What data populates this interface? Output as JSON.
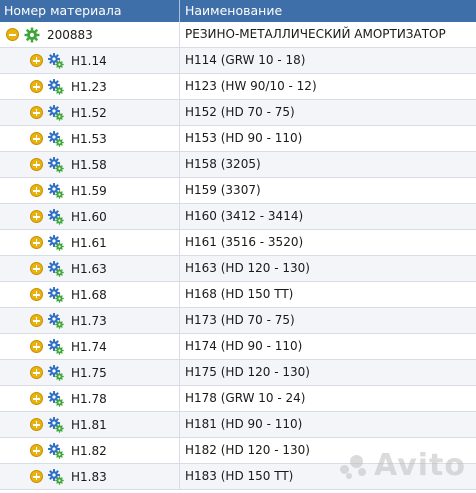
{
  "columns": {
    "material_number": "Номер материала",
    "name": "Наименование"
  },
  "root": {
    "code": "200883",
    "name": "РЕЗИНО-МЕТАЛЛИЧЕСКИЙ АМОРТИЗАТОР",
    "expander": "minus-icon"
  },
  "rows": [
    {
      "code": "H1.14",
      "name": "H114 (GRW 10 - 18)"
    },
    {
      "code": "H1.23",
      "name": "H123 (HW 90/10 - 12)"
    },
    {
      "code": "H1.52",
      "name": "H152 (HD 70 - 75)"
    },
    {
      "code": "H1.53",
      "name": "H153 (HD 90 - 110)"
    },
    {
      "code": "H1.58",
      "name": "H158 (3205)"
    },
    {
      "code": "H1.59",
      "name": "H159 (3307)"
    },
    {
      "code": "H1.60",
      "name": "H160 (3412 - 3414)"
    },
    {
      "code": "H1.61",
      "name": "H161 (3516 - 3520)"
    },
    {
      "code": "H1.63",
      "name": "H163 (HD 120 - 130)"
    },
    {
      "code": "H1.68",
      "name": "H168 (HD 150 TT)"
    },
    {
      "code": "H1.73",
      "name": "H173 (HD 70 - 75)"
    },
    {
      "code": "H1.74",
      "name": "H174 (HD 90 - 110)"
    },
    {
      "code": "H1.75",
      "name": "H175 (HD 120 - 130)"
    },
    {
      "code": "H1.78",
      "name": "H178 (GRW 10 - 24)"
    },
    {
      "code": "H1.81",
      "name": "H181 (HD 90 - 110)"
    },
    {
      "code": "H1.82",
      "name": "H182 (HD 120 - 130)"
    },
    {
      "code": "H1.83",
      "name": "H183 (HD 150 TT)"
    }
  ],
  "watermark": "Avito",
  "colors": {
    "header_bg": "#3f6fa8",
    "expander": "#e8b30e",
    "gear_blue": "#2f6fc4",
    "gear_green": "#3fa63a"
  }
}
